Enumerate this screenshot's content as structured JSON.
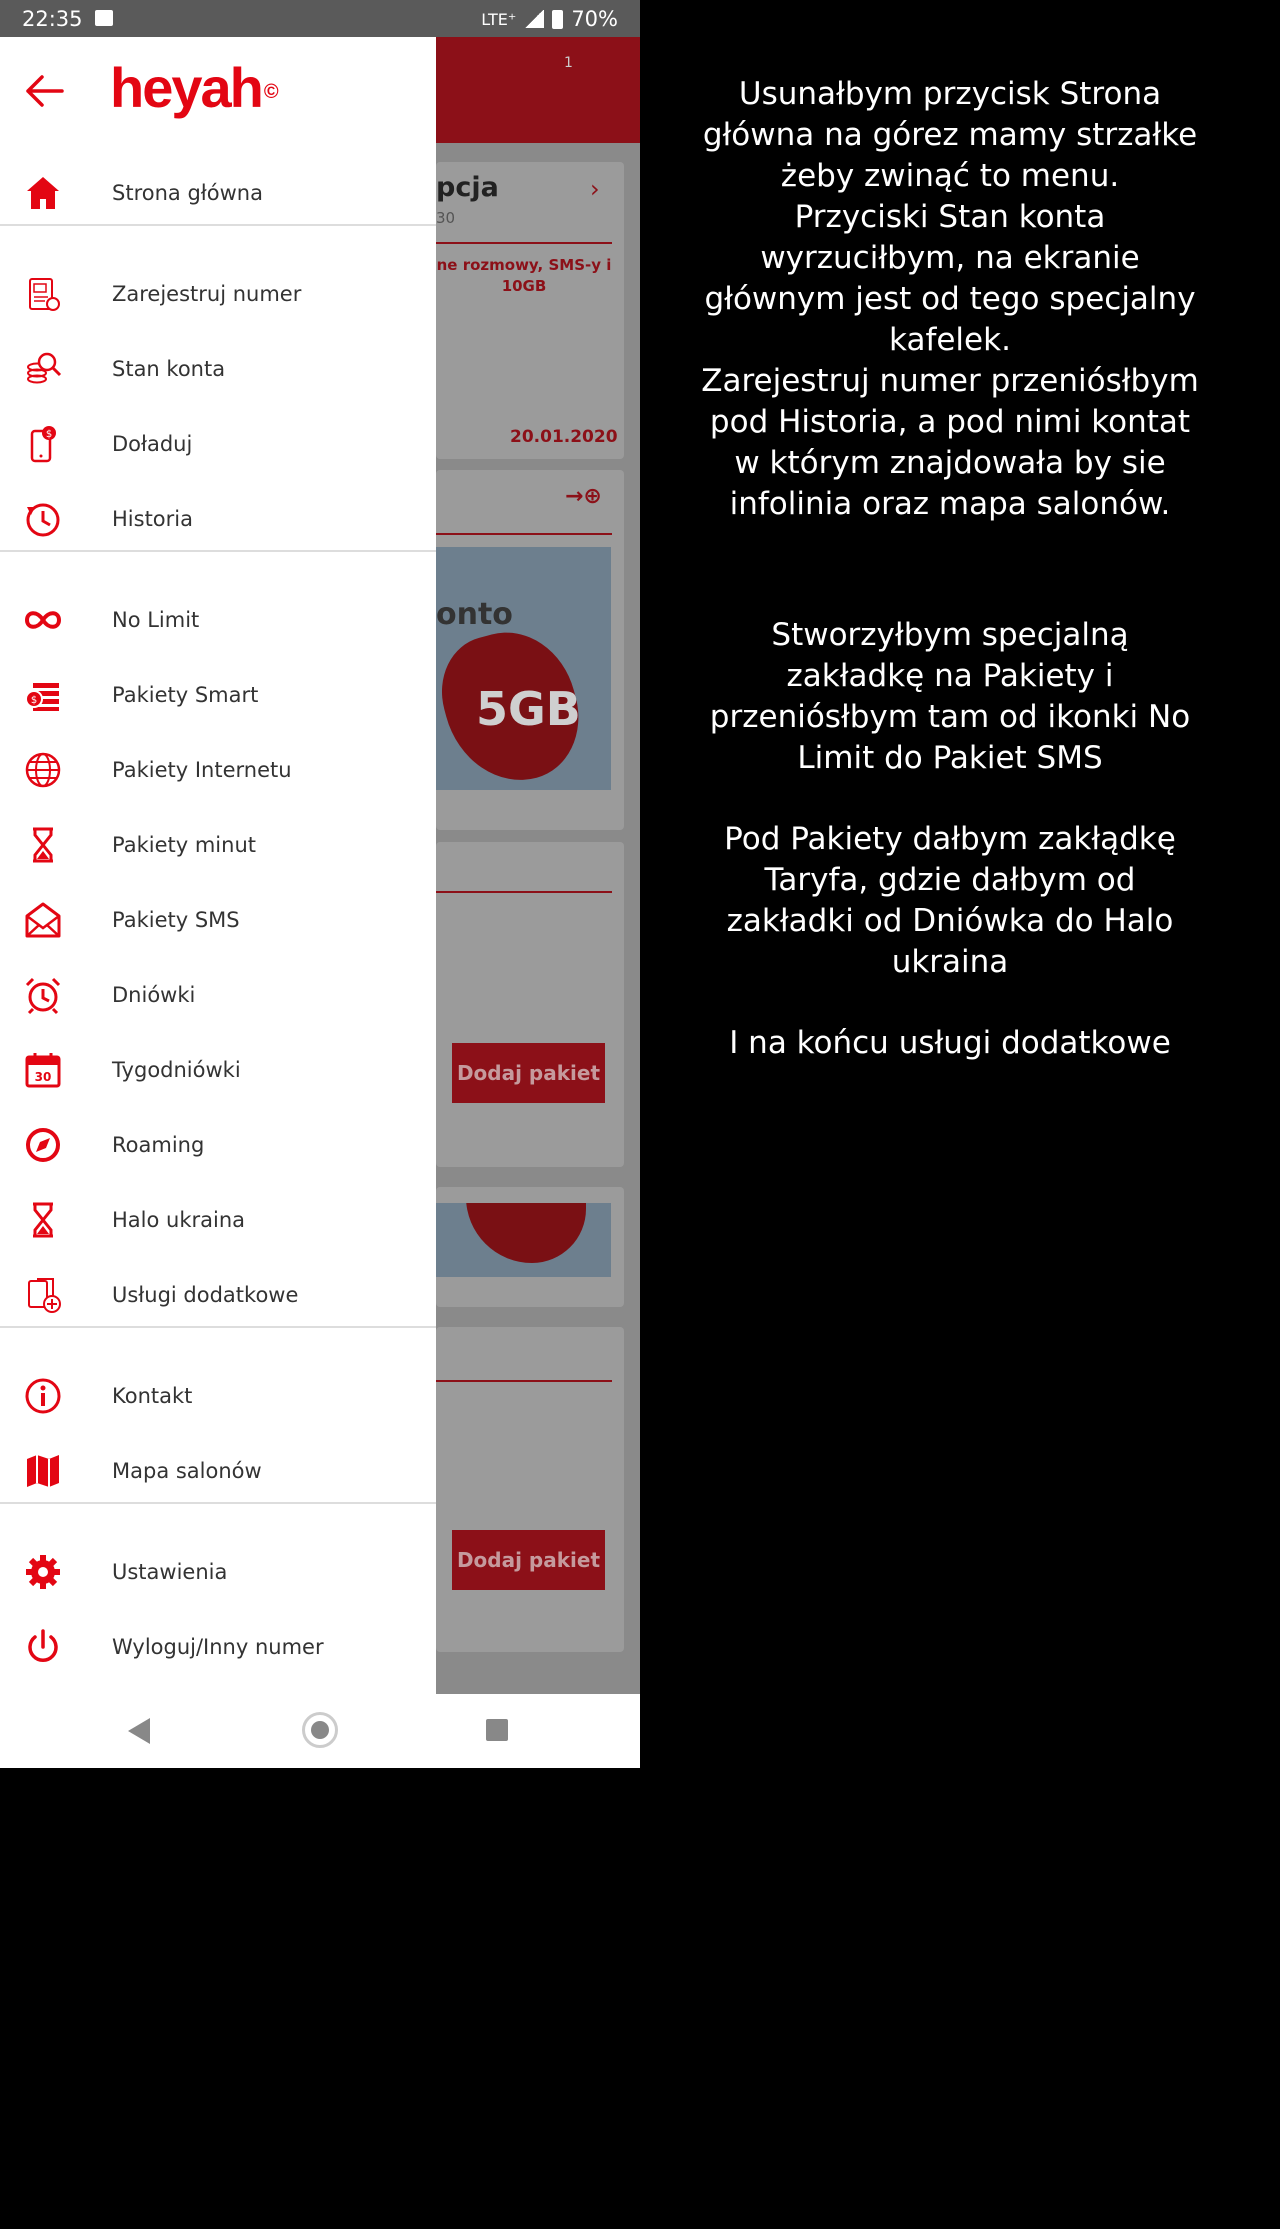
{
  "status_bar": {
    "time": "22:35",
    "network": "LTE⁺",
    "battery": "70%"
  },
  "app": {
    "logo": "heyah",
    "logo_mark": "©"
  },
  "background": {
    "card1_title": "pcja",
    "card1_sub": "30",
    "card1_desc": "ne rozmowy, SMS-y i 10GB",
    "card1_date": "20.01.2020",
    "promo_text": "onto",
    "promo_badge": "5GB",
    "add_package_1": "Dodaj pakiet",
    "add_package_2": "Dodaj pakiet",
    "mail_badge": "1"
  },
  "menu": {
    "groups": [
      [
        {
          "label": "Strona główna",
          "icon": "home-icon"
        }
      ],
      [
        {
          "label": "Zarejestruj numer",
          "icon": "sim-register-icon"
        },
        {
          "label": "Stan konta",
          "icon": "coins-search-icon"
        },
        {
          "label": "Doładuj",
          "icon": "phone-topup-icon"
        },
        {
          "label": "Historia",
          "icon": "history-icon"
        }
      ],
      [
        {
          "label": "No Limit",
          "icon": "infinity-icon"
        },
        {
          "label": "Pakiety Smart",
          "icon": "smart-package-icon"
        },
        {
          "label": "Pakiety Internetu",
          "icon": "globe-icon"
        },
        {
          "label": "Pakiety minut",
          "icon": "hourglass-icon"
        },
        {
          "label": "Pakiety SMS",
          "icon": "envelope-icon"
        },
        {
          "label": "Dniówki",
          "icon": "alarm-clock-icon"
        },
        {
          "label": "Tygodniówki",
          "icon": "calendar-icon"
        },
        {
          "label": "Roaming",
          "icon": "compass-icon"
        },
        {
          "label": "Halo ukraina",
          "icon": "hourglass-icon"
        },
        {
          "label": "Usługi dodatkowe",
          "icon": "extra-services-icon"
        }
      ],
      [
        {
          "label": "Kontakt",
          "icon": "info-icon"
        },
        {
          "label": "Mapa salonów",
          "icon": "map-icon"
        }
      ],
      [
        {
          "label": "Ustawienia",
          "icon": "gear-icon"
        },
        {
          "label": "Wyloguj/Inny numer",
          "icon": "power-icon"
        }
      ]
    ]
  },
  "notes": [
    "Usunałbym przycisk Strona\ngłówna na górez mamy strzałke\nżeby zwinąć to menu.\nPrzyciski Stan konta\nwyrzuciłbym, na ekranie\ngłównym jest od tego specjalny\nkafelek.\nZarejestruj numer przeniósłbym\npod Historia, a pod nimi kontat\nw którym znajdowała by sie\ninfolinia oraz mapa salonów.",
    "Stworzyłbym specjalną\nzakładkę na Pakiety i\nprzeniósłbym tam od ikonki No\nLimit do Pakiet SMS",
    "Pod Pakiety dałbym zakłądkę\nTaryfa, gdzie dałbym od\nzakładki od Dniówka do Halo\nukraina",
    "I na końcu usługi dodatkowe"
  ],
  "colors": {
    "brand_red": "#e30613",
    "dim_red": "#8c1018"
  }
}
